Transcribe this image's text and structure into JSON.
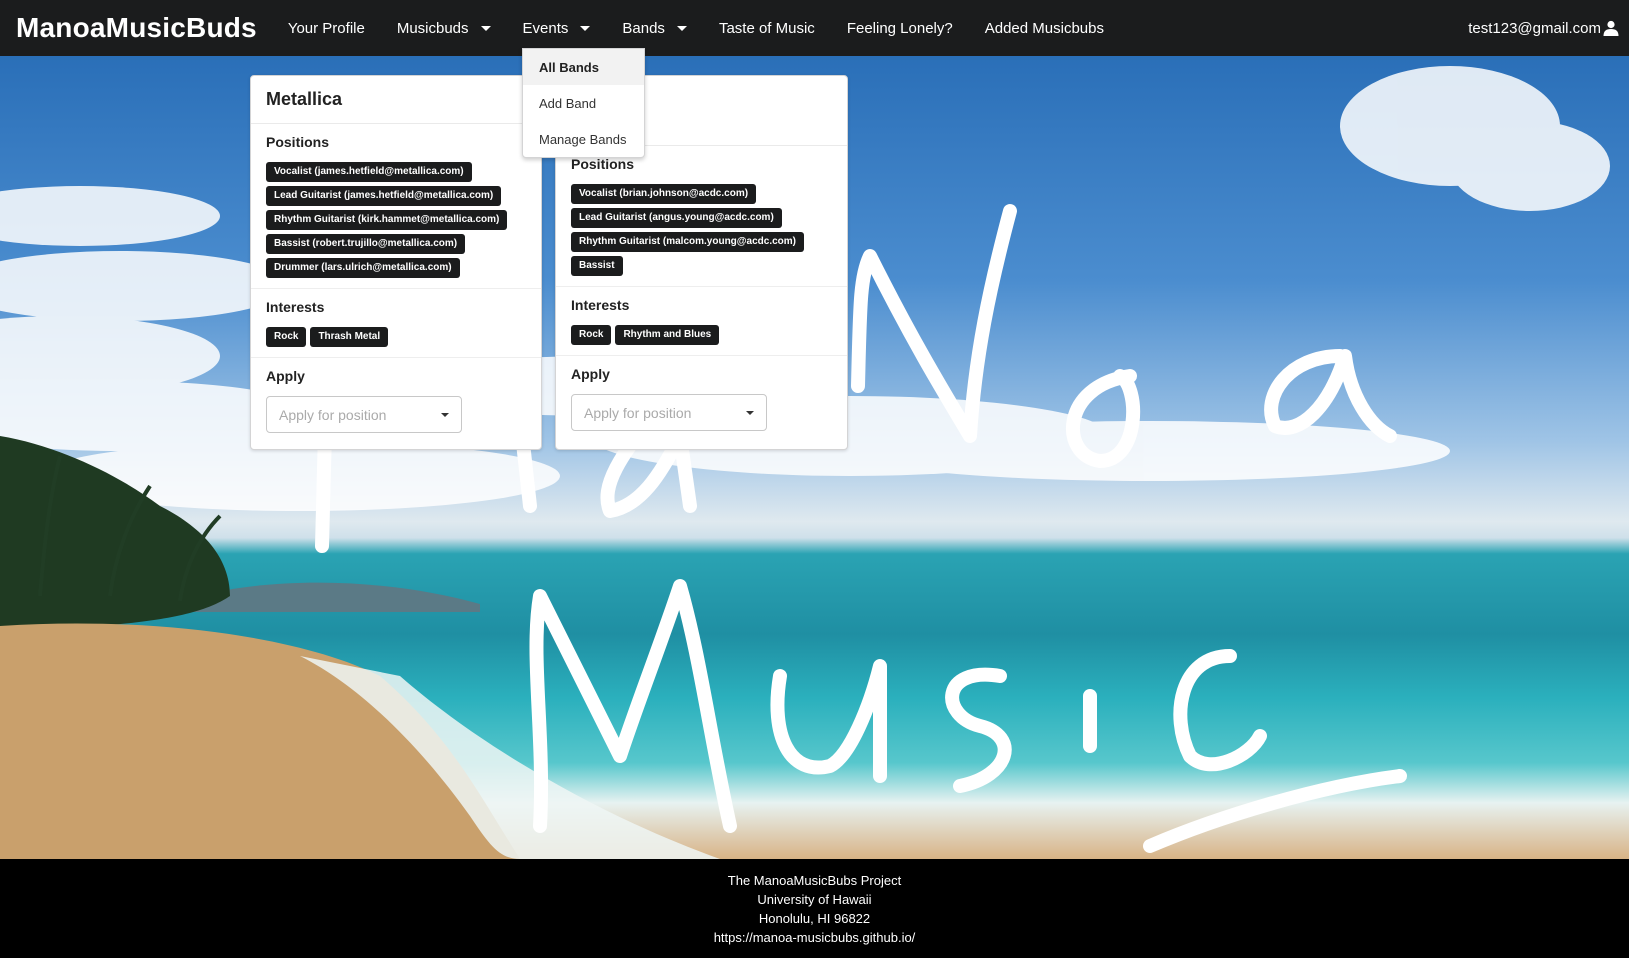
{
  "navbar": {
    "brand": "ManoaMusicBuds",
    "items": [
      {
        "label": "Your Profile",
        "caret": false
      },
      {
        "label": "Musicbuds",
        "caret": true
      },
      {
        "label": "Events",
        "caret": true
      },
      {
        "label": "Bands",
        "caret": true
      },
      {
        "label": "Taste of Music",
        "caret": false
      },
      {
        "label": "Feeling Lonely?",
        "caret": false
      },
      {
        "label": "Added Musicbubs",
        "caret": false
      }
    ],
    "user": "test123@gmail.com",
    "user_icon": "user-icon"
  },
  "dropdown": {
    "items": [
      "All Bands",
      "Add Band",
      "Manage Bands"
    ],
    "active": "All Bands"
  },
  "cards": [
    {
      "title": "Metallica",
      "positions_title": "Positions",
      "positions": [
        "Vocalist (james.hetfield@metallica.com)",
        "Lead Guitarist (james.hetfield@metallica.com)",
        "Rhythm Guitarist (kirk.hammet@metallica.com)",
        "Bassist (robert.trujillo@metallica.com)",
        "Drummer (lars.ulrich@metallica.com)"
      ],
      "interests_title": "Interests",
      "interests": [
        "Rock",
        "Thrash Metal"
      ],
      "apply_title": "Apply",
      "apply_placeholder": "Apply for position"
    },
    {
      "title": "",
      "positions_title": "Positions",
      "positions": [
        "Vocalist (brian.johnson@acdc.com)",
        "Lead Guitarist (angus.young@acdc.com)",
        "Rhythm Guitarist (malcom.young@acdc.com)",
        "Bassist"
      ],
      "interests_title": "Interests",
      "interests": [
        "Rock",
        "Rhythm and Blues"
      ],
      "apply_title": "Apply",
      "apply_placeholder": "Apply for position"
    }
  ],
  "footer": {
    "line1": "The ManoaMusicBubs Project",
    "line2": "University of Hawaii",
    "line3": "Honolulu, HI 96822",
    "line4": "https://manoa-musicbubs.github.io/"
  }
}
